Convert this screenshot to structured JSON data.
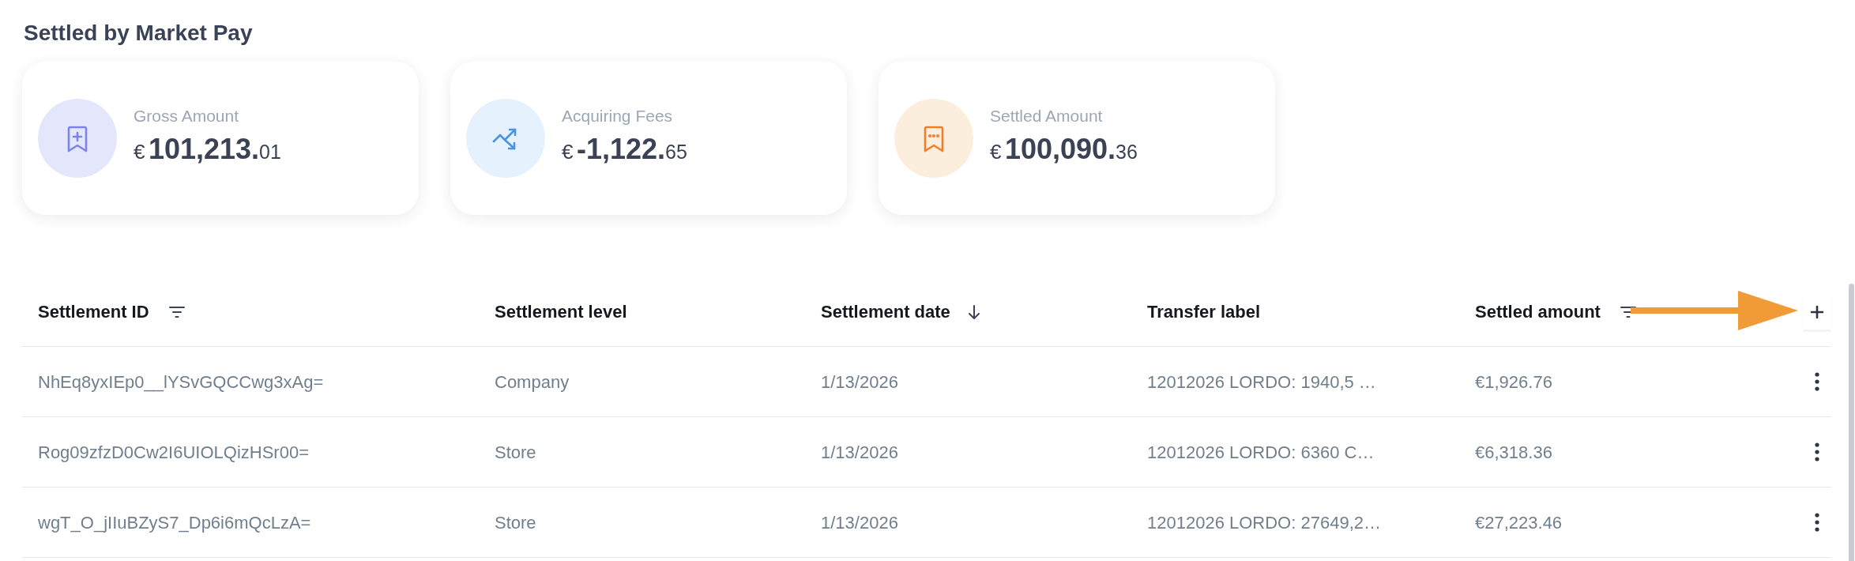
{
  "title": "Settled by Market Pay",
  "cards": [
    {
      "kind": "gross",
      "label": "Gross Amount",
      "currency": "€",
      "amount_main": "101,213.",
      "amount_cents": "01"
    },
    {
      "kind": "fees",
      "label": "Acquiring Fees",
      "currency": "€",
      "amount_main": "-1,122.",
      "amount_cents": "65"
    },
    {
      "kind": "settled",
      "label": "Settled Amount",
      "currency": "€",
      "amount_main": "100,090.",
      "amount_cents": "36"
    }
  ],
  "table": {
    "columns": [
      {
        "label": "Settlement ID",
        "kind": "filter"
      },
      {
        "label": "Settlement level",
        "kind": "plain"
      },
      {
        "label": "Settlement date",
        "kind": "sort"
      },
      {
        "label": "Transfer label",
        "kind": "plain"
      },
      {
        "label": "Settled amount",
        "kind": "filter"
      }
    ],
    "rows": [
      {
        "cells": [
          "NhEq8yxIEp0__lYSvGQCCwg3xAg=",
          "Company",
          "1/13/2026",
          "12012026 LORDO: 1940,5 …",
          "€1,926.76"
        ]
      },
      {
        "cells": [
          "Rog09zfzD0Cw2I6UIOLQizHSr00=",
          "Store",
          "1/13/2026",
          "12012026 LORDO: 6360 C…",
          "€6,318.36"
        ]
      },
      {
        "cells": [
          "wgT_O_jIIuBZyS7_Dp6i6mQcLzA=",
          "Store",
          "1/13/2026",
          "12012026 LORDO: 27649,2…",
          "€27,223.46"
        ]
      }
    ]
  }
}
